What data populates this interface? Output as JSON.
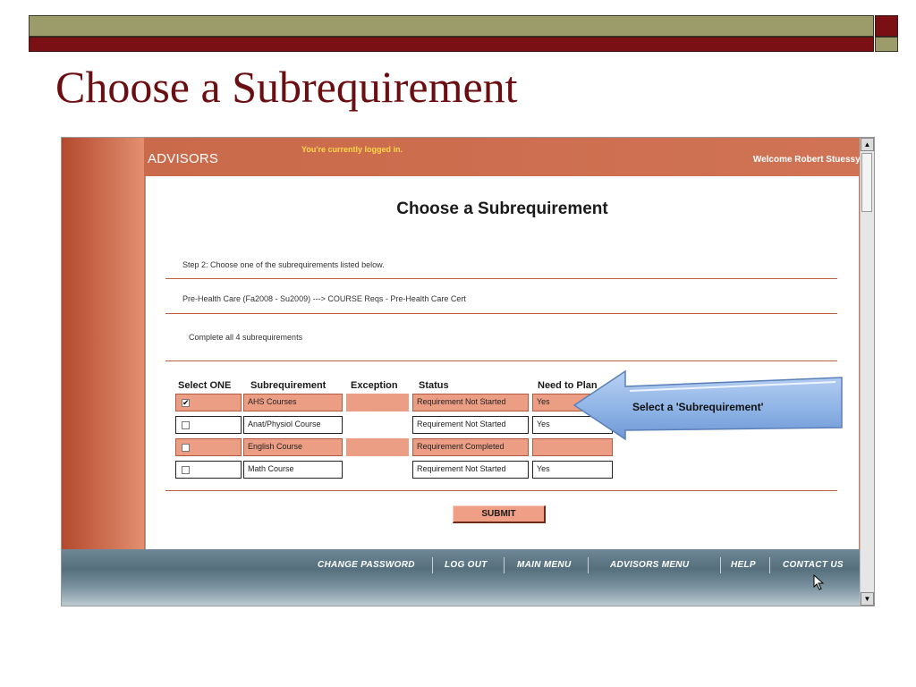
{
  "slide": {
    "title": "Choose a Subrequirement"
  },
  "app": {
    "brand": "ADVISORS",
    "logged_in": "You're currently logged in.",
    "welcome": "Welcome Robert Stuessy!"
  },
  "page": {
    "title": "Choose a Subrequirement",
    "step": "Step 2: Choose one of the subrequirements listed below.",
    "program": "Pre-Health Care (Fa2008 - Su2009) ---> COURSE Reqs - Pre-Health Care Cert",
    "complete": "Complete all 4 subrequirements",
    "columns": [
      "Select ONE",
      "Subrequirement",
      "Exception",
      "Status",
      "Need to Plan"
    ],
    "rows": [
      {
        "checked": "✔",
        "name": "AHS Courses",
        "exception": "",
        "status": "Requirement Not Started",
        "need": "Yes"
      },
      {
        "checked": "",
        "name": "Anat/Physiol Course",
        "exception": "",
        "status": "Requirement Not Started",
        "need": "Yes"
      },
      {
        "checked": "",
        "name": "English Course",
        "exception": "",
        "status": "Requirement Completed",
        "need": ""
      },
      {
        "checked": "",
        "name": "Math Course",
        "exception": "",
        "status": "Requirement Not Started",
        "need": "Yes"
      }
    ],
    "submit": "SUBMIT"
  },
  "callout": {
    "text": "Select a 'Subrequirement'"
  },
  "footer": {
    "nav": [
      "CHANGE PASSWORD",
      "LOG OUT",
      "MAIN MENU",
      "ADVISORS MENU",
      "HELP",
      "CONTACT US"
    ]
  },
  "scroll": {
    "up": "▲",
    "down": "▼"
  },
  "colors": {
    "maroon": "#7a0f14",
    "olive": "#9c9c6a",
    "header_orange": "#c96a4a",
    "row_highlight": "#ec9e85",
    "callout_blue": "#8fb4e6"
  }
}
